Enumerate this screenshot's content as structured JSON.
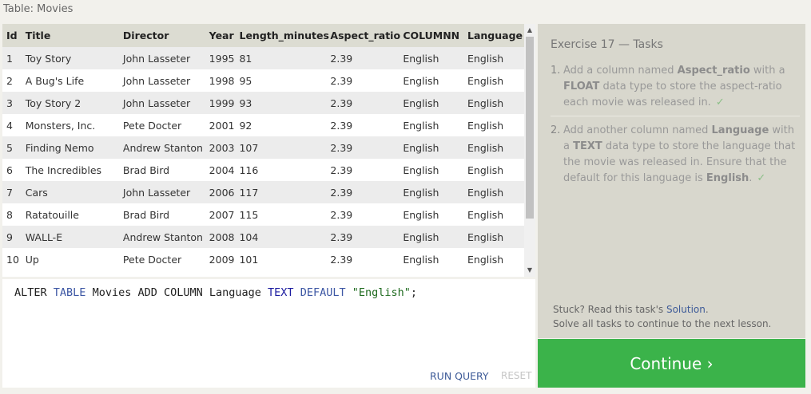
{
  "table": {
    "caption": "Table: Movies",
    "headers": [
      "Id",
      "Title",
      "Director",
      "Year",
      "Length_minutes",
      "Aspect_ratio",
      "COLUMNN",
      "Language"
    ],
    "rows": [
      [
        "1",
        "Toy Story",
        "John Lasseter",
        "1995",
        "81",
        "2.39",
        "English",
        "English"
      ],
      [
        "2",
        "A Bug's Life",
        "John Lasseter",
        "1998",
        "95",
        "2.39",
        "English",
        "English"
      ],
      [
        "3",
        "Toy Story 2",
        "John Lasseter",
        "1999",
        "93",
        "2.39",
        "English",
        "English"
      ],
      [
        "4",
        "Monsters, Inc.",
        "Pete Docter",
        "2001",
        "92",
        "2.39",
        "English",
        "English"
      ],
      [
        "5",
        "Finding Nemo",
        "Andrew Stanton",
        "2003",
        "107",
        "2.39",
        "English",
        "English"
      ],
      [
        "6",
        "The Incredibles",
        "Brad Bird",
        "2004",
        "116",
        "2.39",
        "English",
        "English"
      ],
      [
        "7",
        "Cars",
        "John Lasseter",
        "2006",
        "117",
        "2.39",
        "English",
        "English"
      ],
      [
        "8",
        "Ratatouille",
        "Brad Bird",
        "2007",
        "115",
        "2.39",
        "English",
        "English"
      ],
      [
        "9",
        "WALL-E",
        "Andrew Stanton",
        "2008",
        "104",
        "2.39",
        "English",
        "English"
      ],
      [
        "10",
        "Up",
        "Pete Docter",
        "2009",
        "101",
        "2.39",
        "English",
        "English"
      ]
    ]
  },
  "editor": {
    "code": {
      "alter": "ALTER",
      "table_kw": "TABLE",
      "mid": "Movies ADD COLUMN Language",
      "text_kw": "TEXT",
      "default_kw": "DEFAULT",
      "string": "\"English\"",
      "end": ";"
    },
    "run_label": "RUN QUERY",
    "reset_label": "RESET"
  },
  "tasks": {
    "heading": "Exercise 17 — Tasks",
    "items": [
      {
        "num": "1.",
        "p1": "Add a column named ",
        "b1": "Aspect_ratio",
        "p2": " with a ",
        "b2": "FLOAT",
        "p3": " data type to store the aspect-ratio each movie was released in.",
        "check": "✓"
      },
      {
        "num": "2.",
        "p1": "Add another column named ",
        "b1": "Language",
        "p2": " with a ",
        "b2": "TEXT",
        "p3": " data type to store the language that the movie was released in. Ensure that the default for this language is ",
        "b3": "English",
        "p4": ".",
        "check": "✓"
      }
    ],
    "stuck_text": "Stuck? Read this task's ",
    "solution_link": "Solution",
    "stuck_end": ".",
    "solve_all": "Solve all tasks to continue to the next lesson."
  },
  "continue_label": "Continue ›",
  "icons": {
    "scroll_up": "▲",
    "scroll_down": "▼"
  },
  "colors": {
    "continue_bg": "#3bb34a",
    "link": "#3e5b98",
    "check": "#8bbf87"
  }
}
